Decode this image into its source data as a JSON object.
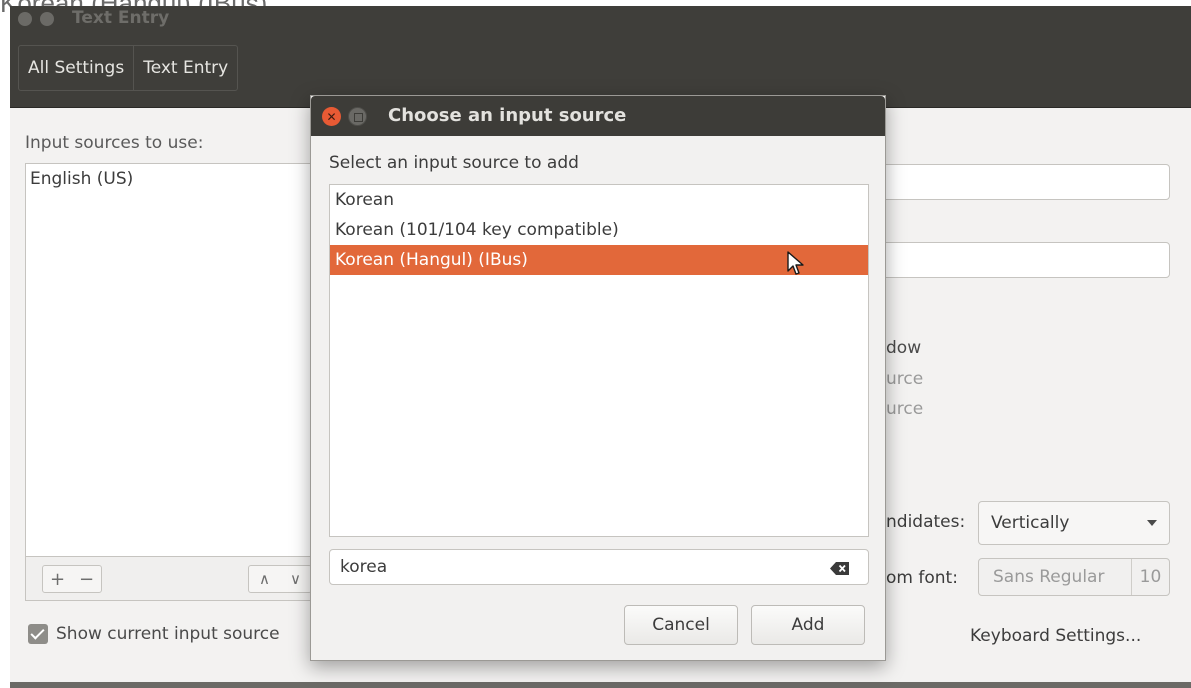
{
  "caption": "Korean (Hangul) (IBus)",
  "main_window": {
    "title": "Text Entry",
    "breadcrumbs": [
      "All Settings",
      "Text Entry"
    ],
    "input_sources_label": "Input sources to use:",
    "input_sources": [
      "English (US)"
    ],
    "toolbar": {
      "add": "+",
      "remove": "−",
      "up": "∧",
      "down": "∨"
    },
    "show_current_source": "Show current input source",
    "partial_labels": {
      "window": "dow",
      "source_1": "urce",
      "source_2": "urce",
      "candidates": "ndidates:",
      "custom_font": "om font:"
    },
    "candidates_orientation": "Vertically",
    "font_name": "Sans Regular",
    "font_size": "10",
    "keyboard_settings": "Keyboard Settings..."
  },
  "dialog": {
    "title": "Choose an input source",
    "prompt": "Select an input source to add",
    "options": [
      "Korean",
      "Korean (101/104 key compatible)",
      "Korean (Hangul) (IBus)"
    ],
    "selected_index": 2,
    "search_value": "korea",
    "cancel_label": "Cancel",
    "add_label": "Add",
    "close_glyph": "✕"
  },
  "colors": {
    "accent": "#e2683a",
    "titlebar": "#3d3c38",
    "close_button": "#e85a34"
  }
}
